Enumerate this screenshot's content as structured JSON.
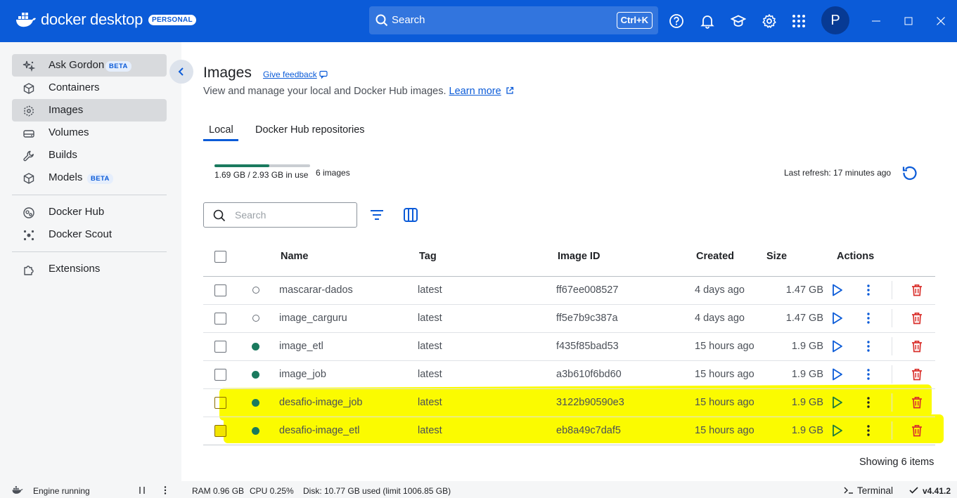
{
  "app": {
    "name": "docker desktop",
    "plan": "PERSONAL",
    "search_placeholder": "Search",
    "search_shortcut": "Ctrl+K",
    "avatar_letter": "P"
  },
  "sidebar": {
    "items": [
      {
        "label": "Ask Gordon",
        "badge": "BETA",
        "icon": "sparkle-icon",
        "active": true
      },
      {
        "label": "Containers",
        "icon": "container-icon"
      },
      {
        "label": "Images",
        "icon": "images-icon",
        "active": true
      },
      {
        "label": "Volumes",
        "icon": "volume-icon"
      },
      {
        "label": "Builds",
        "icon": "wrench-icon"
      },
      {
        "label": "Models",
        "badge": "BETA",
        "icon": "cube-icon"
      },
      {
        "label": "Docker Hub",
        "icon": "hub-icon"
      },
      {
        "label": "Docker Scout",
        "icon": "scout-icon"
      },
      {
        "label": "Extensions",
        "icon": "puzzle-icon"
      }
    ]
  },
  "page": {
    "title": "Images",
    "feedback": "Give feedback",
    "subtitle": "View and manage your local and Docker Hub images.",
    "learn_more": "Learn more",
    "tabs": [
      "Local",
      "Docker Hub repositories"
    ],
    "active_tab": "Local"
  },
  "usage": {
    "text": "1.69 GB / 2.93 GB in use",
    "used_fraction": 0.577,
    "count": "6 images",
    "last_refresh": "Last refresh: 17 minutes ago"
  },
  "toolbar": {
    "search_placeholder": "Search"
  },
  "table": {
    "columns": [
      "Name",
      "Tag",
      "Image ID",
      "Created",
      "Size",
      "Actions"
    ],
    "rows": [
      {
        "name": "mascarar-dados",
        "tag": "latest",
        "image_id": "ff67ee008527",
        "created": "4 days ago",
        "size": "1.47 GB",
        "in_use": false,
        "highlighted": false
      },
      {
        "name": "image_carguru",
        "tag": "latest",
        "image_id": "ff5e7b9c387a",
        "created": "4 days ago",
        "size": "1.47 GB",
        "in_use": false,
        "highlighted": false
      },
      {
        "name": "image_etl",
        "tag": "latest",
        "image_id": "f435f85bad53",
        "created": "15 hours ago",
        "size": "1.9 GB",
        "in_use": true,
        "highlighted": false
      },
      {
        "name": "image_job",
        "tag": "latest",
        "image_id": "a3b610f6bd60",
        "created": "15 hours ago",
        "size": "1.9 GB",
        "in_use": true,
        "highlighted": false
      },
      {
        "name": "desafio-image_job",
        "tag": "latest",
        "image_id": "3122b90590e3",
        "created": "15 hours ago",
        "size": "1.9 GB",
        "in_use": true,
        "highlighted": true
      },
      {
        "name": "desafio-image_etl",
        "tag": "latest",
        "image_id": "eb8a49c7daf5",
        "created": "15 hours ago",
        "size": "1.9 GB",
        "in_use": true,
        "highlighted": true
      }
    ],
    "footer": "Showing 6 items"
  },
  "statusbar": {
    "engine": "Engine running",
    "ram": "RAM 0.96 GB",
    "cpu": "CPU 0.25%",
    "disk": "Disk: 10.77 GB used (limit 1006.85 GB)",
    "terminal": "Terminal",
    "version": "v4.41.2"
  },
  "colors": {
    "brand": "#0b5bd8",
    "in_use": "#1a7a5e",
    "delete": "#d9302c",
    "highlight": "#fbfb00"
  }
}
